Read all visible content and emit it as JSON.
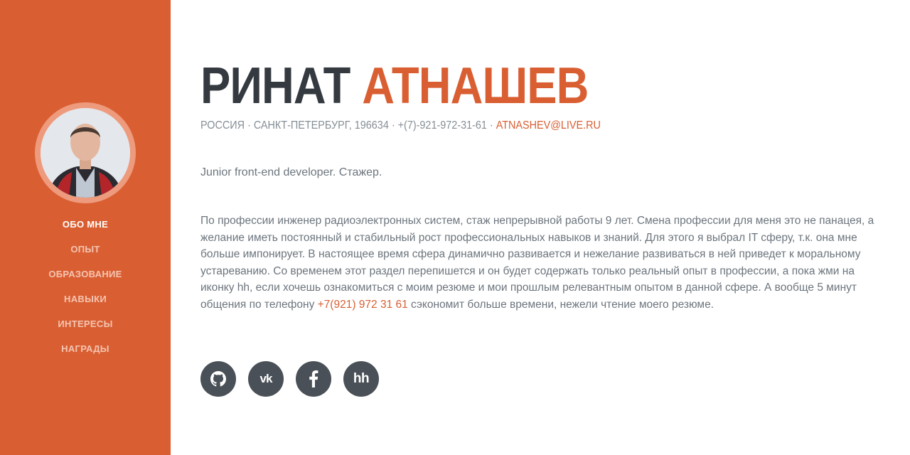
{
  "profile": {
    "first_name": "РИНАТ",
    "last_name": "АТНАШЕВ",
    "location": "РОССИЯ · САНКТ-ПЕТЕРБУРГ, 196634 · +(7)-921-972-31-61 ·",
    "email": "ATNASHEV@LIVE.RU",
    "tagline": "Junior front-end developer. Стажер.",
    "about_part1": "По профессии инженер радиоэлектронных систем, стаж непрерывной работы 9 лет. Смена профессии для меня это не панацея, а желание иметь постоянный и стабильный рост профессиональных навыков и знаний. Для этого я выбрал IT сферу, т.к. она мне больше импонирует. В настоящее время сфера динамично развивается и нежелание развиваться в ней приведет к моральному устареванию. Со временем этот раздел перепишется и он будет содержать только реальный опыт в профессии, а пока жми на иконку hh, если хочешь ознакомиться с моим резюме и мои прошлым релевантным опытом в данной сфере. А вообще 5 минут общения по телефону ",
    "about_phone": "+7(921) 972 31 61",
    "about_part2": " сэкономит больше времени, нежели чтение моего резюме."
  },
  "nav": [
    {
      "label": "ОБО МНЕ",
      "active": true
    },
    {
      "label": "ОПЫТ"
    },
    {
      "label": "ОБРАЗОВАНИЕ"
    },
    {
      "label": "НАВЫКИ"
    },
    {
      "label": "ИНТЕРЕСЫ"
    },
    {
      "label": "НАГРАДЫ"
    }
  ],
  "social": [
    {
      "icon": "github-icon"
    },
    {
      "icon": "vk-icon",
      "text": "vk"
    },
    {
      "icon": "facebook-icon"
    },
    {
      "icon": "hh-icon",
      "text": "hh"
    }
  ],
  "colors": {
    "accent": "#d95f33",
    "dark": "#343a40",
    "text": "#6c757d",
    "icon_bg": "#495057"
  }
}
